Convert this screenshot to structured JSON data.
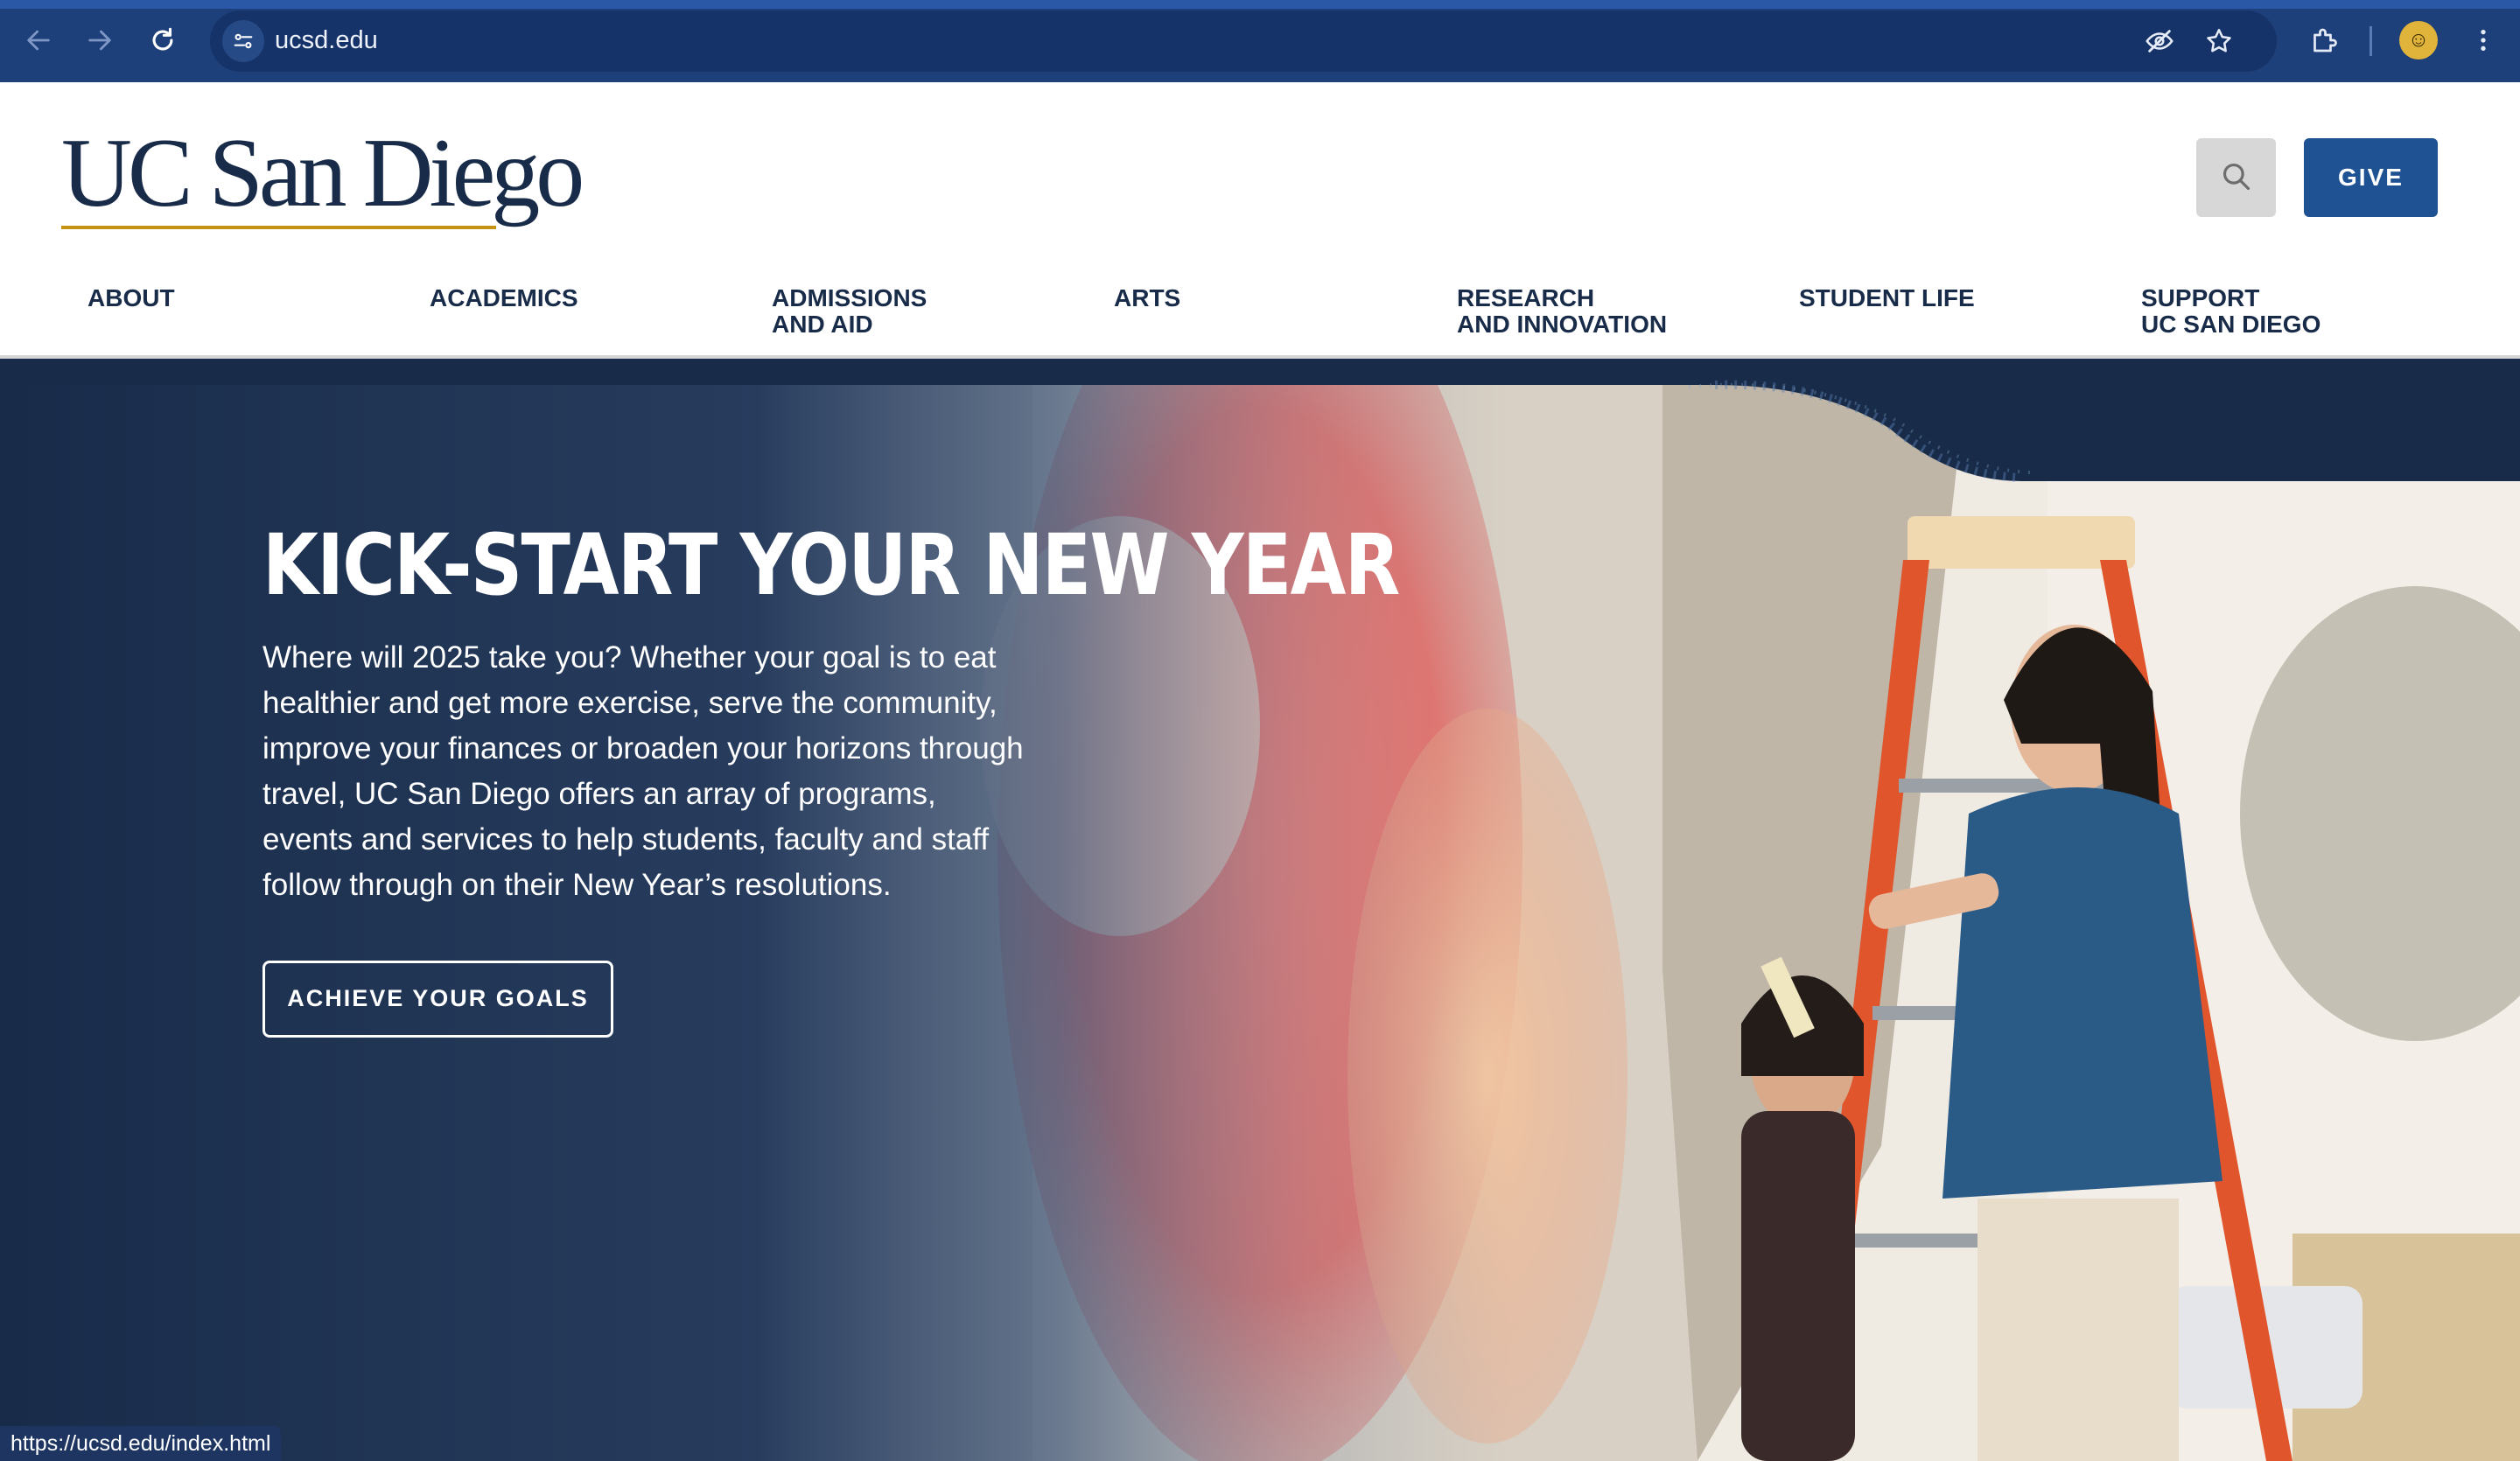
{
  "browser": {
    "url": "ucsd.edu",
    "status_url": "https://ucsd.edu/index.html",
    "icons": [
      "back-arrow-icon",
      "forward-arrow-icon",
      "reload-icon",
      "site-info-icon",
      "eye-off-icon",
      "star-icon",
      "extensions-icon",
      "profile-avatar",
      "more-vert-icon"
    ]
  },
  "header": {
    "logo_text": "UC San Diego",
    "give_label": "GIVE",
    "search_icon": "search-icon"
  },
  "nav": {
    "items": [
      {
        "label": "ABOUT"
      },
      {
        "label": "ACADEMICS"
      },
      {
        "label": "ADMISSIONS\nAND AID"
      },
      {
        "label": "ARTS"
      },
      {
        "label": "RESEARCH\nAND INNOVATION"
      },
      {
        "label": "STUDENT LIFE"
      },
      {
        "label": "SUPPORT\nUC SAN DIEGO"
      }
    ]
  },
  "hero": {
    "title": "KICK-START YOUR NEW YEAR",
    "text": "Where will 2025 take you? Whether your goal is to eat healthier and get more exercise, serve the community, improve your finances or broaden your horizons through travel, UC San Diego offers an array of programs, events and services to help students, faculty and staff follow through on their New Year’s resolutions.",
    "cta_label": "ACHIEVE YOUR GOALS"
  },
  "colors": {
    "navy": "#182b49",
    "gold": "#c69214",
    "give_blue": "#1f5293",
    "chrome_blue": "#1d3f7a",
    "accent_cyan": "#4fbcd4"
  }
}
